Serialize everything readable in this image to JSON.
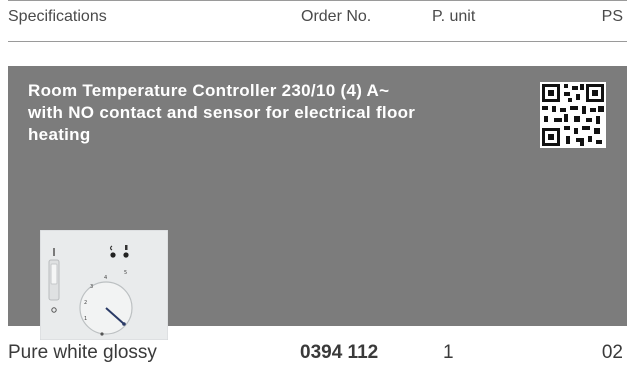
{
  "table_header": {
    "specifications": "Specifications",
    "order_no": "Order No.",
    "p_unit": "P. unit",
    "ps": "PS"
  },
  "product": {
    "title_line1": "Room Temperature Controller 230/10 (4) A~",
    "title_line2": "with NO contact and sensor for electrical floor",
    "title_line3": "heating",
    "panel_color": "#7c7c7c"
  },
  "variant_row": {
    "description": "Pure white glossy",
    "order_no": "0394 112",
    "p_unit": "1",
    "ps": "02"
  },
  "icons": {
    "qr": "qr-code-icon",
    "photo": "product-photo"
  }
}
